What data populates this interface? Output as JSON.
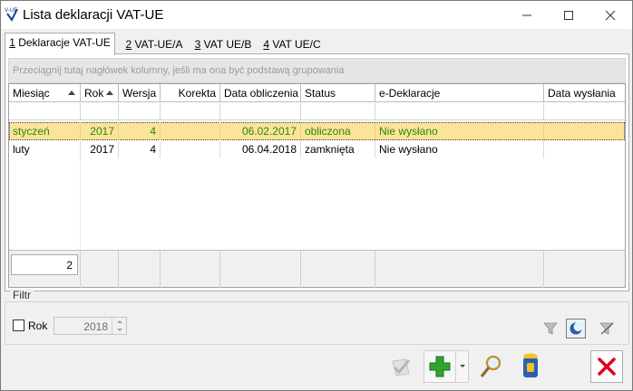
{
  "window": {
    "title": "Lista deklaracji VAT-UE",
    "app_icon_text": "V-UE"
  },
  "tabs": [
    {
      "key": "1",
      "label": " Deklaracje VAT-UE",
      "active": true
    },
    {
      "key": "2",
      "label": " VAT-UE/A",
      "active": false
    },
    {
      "key": "3",
      "label": " VAT UE/B",
      "active": false
    },
    {
      "key": "4",
      "label": " VAT UE/C",
      "active": false
    }
  ],
  "grid": {
    "group_hint": "Przeciągnij tutaj nagłówek kolumny, jeśli ma ona być podstawą grupowania",
    "columns": [
      "Miesiąc",
      "Rok",
      "Wersja",
      "Korekta",
      "Data obliczenia",
      "Status",
      "e-Deklaracje",
      "Data wysłania"
    ],
    "rows": [
      [
        "styczeń",
        "2017",
        "4",
        "",
        "06.02.2017",
        "obliczona",
        "Nie wysłano",
        ""
      ],
      [
        "luty",
        "2017",
        "4",
        "",
        "06.04.2018",
        "zamknięta",
        "Nie wysłano",
        ""
      ]
    ],
    "selected_row": 0,
    "row_count": "2"
  },
  "filter": {
    "legend": "Filtr",
    "rok_label": "Rok",
    "rok_checked": false,
    "rok_value": "2018"
  },
  "icons": {
    "approve": "checkmark-icon",
    "add": "plus-icon",
    "preview": "magnifier-icon",
    "delete": "trash-bin-icon",
    "close": "red-x-icon",
    "filter": "funnel-icon",
    "quick_filter": "moon-icon",
    "clear_filter": "funnel-clear-icon"
  },
  "colors": {
    "selected_row_bg": "#fbe39a",
    "selected_row_text": "#2b8a00",
    "add_green": "#2fa52f",
    "close_red": "#e0001a"
  }
}
